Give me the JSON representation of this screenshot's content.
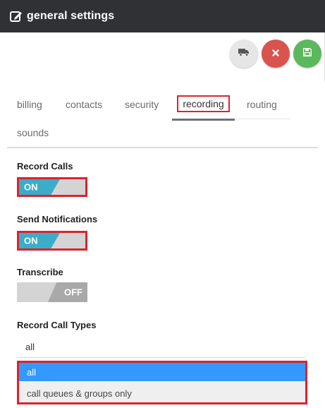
{
  "header": {
    "title": "general settings"
  },
  "actions": {
    "truck_icon": "truck-icon",
    "cancel_icon": "close-icon",
    "save_icon": "save-icon",
    "colors": {
      "cancel": "#d9534f",
      "save": "#5cb85c"
    }
  },
  "tabs": [
    {
      "label": "billing"
    },
    {
      "label": "contacts"
    },
    {
      "label": "security"
    },
    {
      "label": "recording",
      "active": true
    },
    {
      "label": "routing"
    },
    {
      "label": "sounds"
    }
  ],
  "record_calls": {
    "label": "Record Calls",
    "state": "ON"
  },
  "send_notifications": {
    "label": "Send Notifications",
    "state": "ON"
  },
  "transcribe": {
    "label": "Transcribe",
    "state": "OFF"
  },
  "record_call_types": {
    "label": "Record Call Types",
    "selected": "all",
    "options": [
      "all",
      "call queues & groups only"
    ]
  },
  "accent_color": "#3badc8",
  "highlight_color": "#d9242f"
}
